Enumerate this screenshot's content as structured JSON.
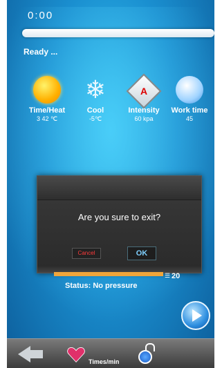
{
  "app": {
    "timer": "0:00",
    "status_text": "Ready ..."
  },
  "stats": [
    {
      "label": "Time/Heat",
      "value": "3    42 ℃",
      "icon": "sun-icon"
    },
    {
      "label": "Cool",
      "value": "-5℃",
      "icon": "snowflake-icon"
    },
    {
      "label": "Intensity",
      "value": "60 kpa",
      "icon": "intensity-diamond-icon"
    },
    {
      "label": "Work time",
      "value": "45",
      "icon": "clock-icon"
    }
  ],
  "dialog": {
    "message": "Are you sure to exit?",
    "cancel_label": "Cancel",
    "ok_label": "OK"
  },
  "progress": {
    "value": "20"
  },
  "status": {
    "text": "Status: No pressure"
  },
  "bottom": {
    "times_label": "Times/min"
  },
  "colors": {
    "accent_orange": "#f0a53a",
    "background_blue": "#1a8fd0"
  }
}
